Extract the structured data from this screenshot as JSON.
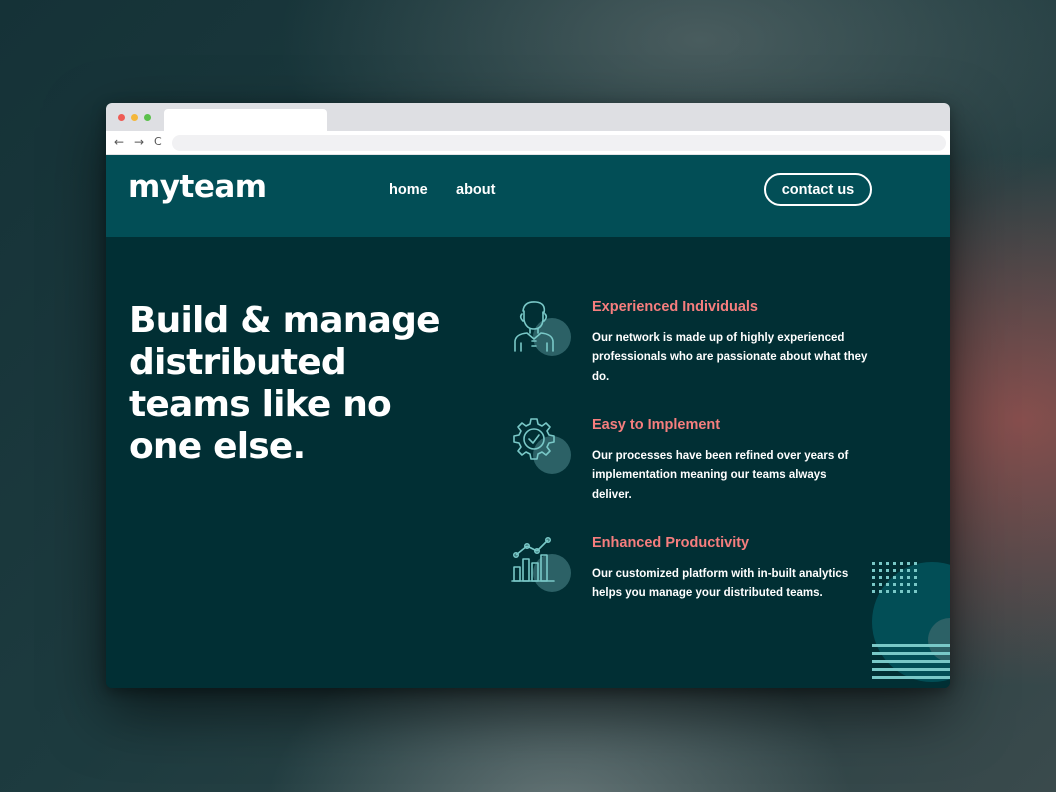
{
  "browser": {
    "tab_title": "",
    "url": "",
    "nav": {
      "back": "←",
      "forward": "→",
      "reload": "C"
    }
  },
  "header": {
    "logo": "myteam",
    "nav": {
      "home": "home",
      "about": "about"
    },
    "contact_label": "contact us"
  },
  "hero": {
    "headline": "Build & manage distributed teams like no one else."
  },
  "features": [
    {
      "icon": "person-icon",
      "title": "Experienced Individuals",
      "description": "Our network is made up of highly experienced professionals who are passionate about what they do."
    },
    {
      "icon": "gear-check-icon",
      "title": "Easy to Implement",
      "description": "Our processes have been refined over years of implementation meaning our teams always deliver."
    },
    {
      "icon": "chart-icon",
      "title": "Enhanced Productivity",
      "description": "Our customized platform with in-built analytics helps you manage your distributed teams."
    }
  ],
  "colors": {
    "header_bg": "#024e56",
    "hero_bg": "#012f34",
    "accent_coral": "#f67e7e",
    "accent_teal": "#79c8c7",
    "white": "#ffffff"
  }
}
